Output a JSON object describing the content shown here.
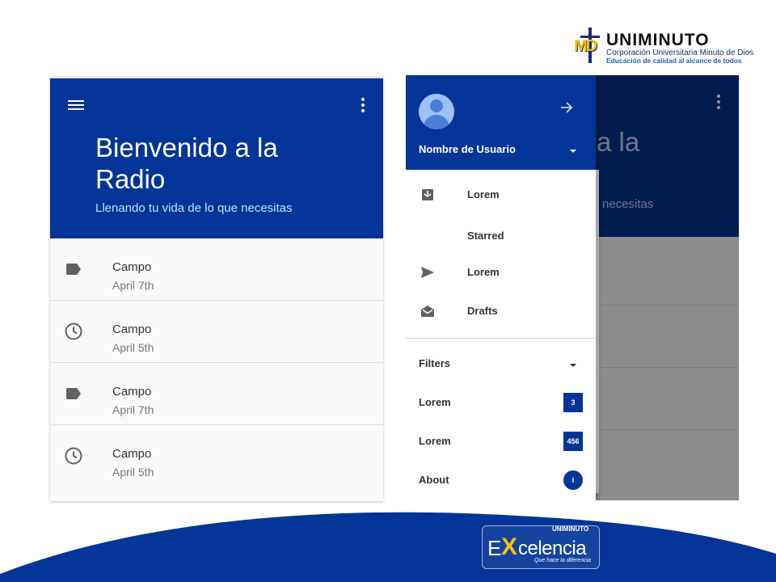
{
  "colors": {
    "primary": "#023597",
    "header_dimmed": "#011c4f",
    "overlay": "#8c8c8c",
    "subtitle": "#b6e4ff",
    "accent_yellow": "#f5c400",
    "wave": "#023597"
  },
  "logo_top": {
    "title": "UNIMINUTO",
    "subtitle1": "Corporación Universitaria Minuto de Dios",
    "subtitle2": "Educación de calidad al alcance de todos",
    "mark": "MD"
  },
  "left_screen": {
    "menu_icon": "hamburger-menu-icon",
    "more_icon": "more-vert-icon",
    "title": "Bienvenido a la Radio",
    "subtitle": "Llenando tu vida de lo que necesitas",
    "items": [
      {
        "icon": "label-icon",
        "title": "Campo",
        "date": "April 7th"
      },
      {
        "icon": "clock-icon",
        "title": "Campo",
        "date": "April 5th"
      },
      {
        "icon": "label-icon",
        "title": "Campo",
        "date": "April 7th"
      },
      {
        "icon": "clock-icon",
        "title": "Campo",
        "date": "April 5th"
      }
    ]
  },
  "right_screen": {
    "title_peek": "a la",
    "subtitle_peek": "necesitas",
    "drawer": {
      "user_name": "Nombre de Usuario",
      "avatar_icon": "account-circle-icon",
      "arrow_icon": "arrow-forward-icon",
      "items": [
        {
          "icon": "inbox-icon",
          "label": "Lorem"
        },
        {
          "icon": "star-icon",
          "label": "Starred",
          "glyph": ""
        },
        {
          "icon": "send-icon",
          "label": "Lorem"
        },
        {
          "icon": "drafts-icon",
          "label": "Drafts"
        }
      ],
      "filters": {
        "label": "Filters",
        "items": [
          {
            "label": "Lorem",
            "badge": "3"
          },
          {
            "label": "Lorem",
            "badge": "456"
          }
        ],
        "about": {
          "label": "About",
          "badge": "i"
        }
      }
    }
  },
  "logo_bottom": {
    "top": "UNIMINUTO",
    "e": "E",
    "x": "X",
    "rest": "celencia",
    "tagline": "Que hace la diferencia"
  }
}
